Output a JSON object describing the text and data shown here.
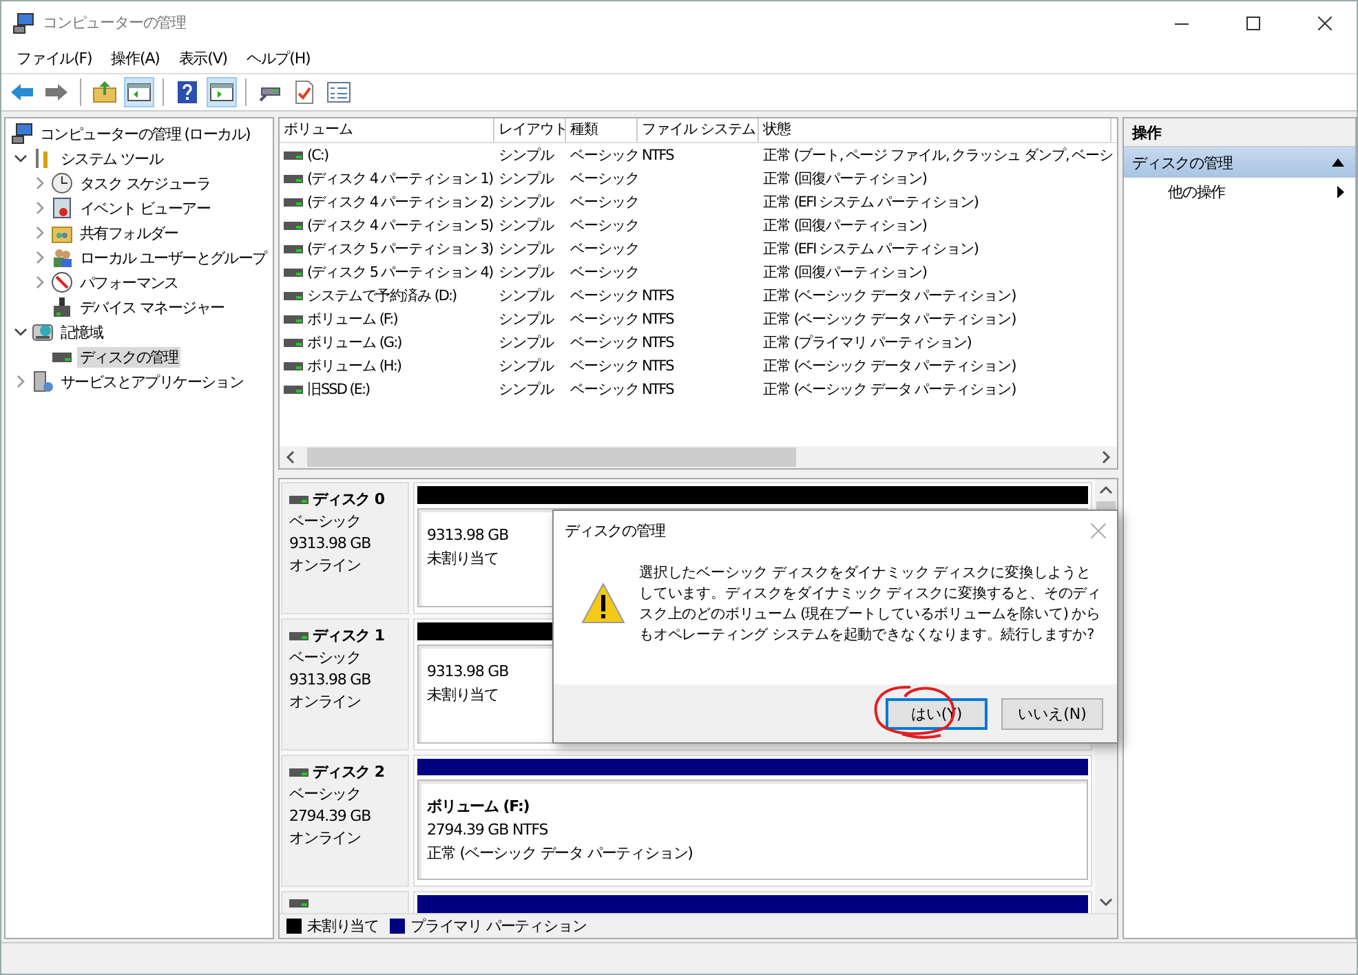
{
  "window": {
    "title": "コンピューターの管理"
  },
  "menu": [
    "ファイル(F)",
    "操作(A)",
    "表示(V)",
    "ヘルプ(H)"
  ],
  "toolbar": [
    {
      "kind": "back",
      "pressed": false
    },
    {
      "kind": "forward",
      "pressed": false
    },
    {
      "kind": "sep"
    },
    {
      "kind": "up",
      "pressed": false
    },
    {
      "kind": "tree",
      "pressed": true
    },
    {
      "kind": "sep"
    },
    {
      "kind": "help",
      "pressed": false
    },
    {
      "kind": "pane",
      "pressed": true
    },
    {
      "kind": "sep"
    },
    {
      "kind": "connect",
      "pressed": false
    },
    {
      "kind": "check",
      "pressed": false
    },
    {
      "kind": "list",
      "pressed": false
    }
  ],
  "tree": [
    {
      "label": "コンピューターの管理 (ローカル)",
      "selected": false,
      "children": [
        {
          "label": "システム ツール",
          "expanded": true,
          "selected": false,
          "children": [
            {
              "label": "タスク スケジューラ",
              "expanded": false,
              "selected": false
            },
            {
              "label": "イベント ビューアー",
              "expanded": false,
              "selected": false
            },
            {
              "label": "共有フォルダー",
              "expanded": false,
              "selected": false
            },
            {
              "label": "ローカル ユーザーとグループ",
              "expanded": false,
              "selected": false
            },
            {
              "label": "パフォーマンス",
              "expanded": false,
              "selected": false
            },
            {
              "label": "デバイス マネージャー",
              "selected": false
            }
          ]
        },
        {
          "label": "記憶域",
          "expanded": true,
          "selected": false,
          "children": [
            {
              "label": "ディスクの管理",
              "selected": true
            }
          ]
        },
        {
          "label": "サービスとアプリケーション",
          "expanded": false,
          "selected": false
        }
      ]
    }
  ],
  "volume_table": {
    "columns": [
      "ボリューム",
      "レイアウト",
      "種類",
      "ファイル システム",
      "状態"
    ],
    "rows": [
      [
        "(C:)",
        "シンプル",
        "ベーシック",
        "NTFS",
        "正常 (ブート, ページ ファイル, クラッシュ ダンプ, ベーシ"
      ],
      [
        "(ディスク 4 パーティション 1)",
        "シンプル",
        "ベーシック",
        "",
        "正常 (回復パーティション)"
      ],
      [
        "(ディスク 4 パーティション 2)",
        "シンプル",
        "ベーシック",
        "",
        "正常 (EFI システム パーティション)"
      ],
      [
        "(ディスク 4 パーティション 5)",
        "シンプル",
        "ベーシック",
        "",
        "正常 (回復パーティション)"
      ],
      [
        "(ディスク 5 パーティション 3)",
        "シンプル",
        "ベーシック",
        "",
        "正常 (EFI システム パーティション)"
      ],
      [
        "(ディスク 5 パーティション 4)",
        "シンプル",
        "ベーシック",
        "",
        "正常 (回復パーティション)"
      ],
      [
        "システムで予約済み (D:)",
        "シンプル",
        "ベーシック",
        "NTFS",
        "正常 (ベーシック データ パーティション)"
      ],
      [
        "ボリューム (F:)",
        "シンプル",
        "ベーシック",
        "NTFS",
        "正常 (ベーシック データ パーティション)"
      ],
      [
        "ボリューム (G:)",
        "シンプル",
        "ベーシック",
        "NTFS",
        "正常 (プライマリ パーティション)"
      ],
      [
        "ボリューム (H:)",
        "シンプル",
        "ベーシック",
        "NTFS",
        "正常 (ベーシック データ パーティション)"
      ],
      [
        "旧SSD (E:)",
        "シンプル",
        "ベーシック",
        "NTFS",
        "正常 (ベーシック データ パーティション)"
      ]
    ]
  },
  "disks": [
    {
      "name": "ディスク 0",
      "type": "ベーシック",
      "size": "9313.98 GB",
      "status": "オンライン",
      "partition": {
        "kind": "unallocated",
        "lines": [
          "9313.98 GB",
          "未割り当て"
        ]
      }
    },
    {
      "name": "ディスク 1",
      "type": "ベーシック",
      "size": "9313.98 GB",
      "status": "オンライン",
      "partition": {
        "kind": "unallocated",
        "lines": [
          "9313.98 GB",
          "未割り当て"
        ]
      }
    },
    {
      "name": "ディスク 2",
      "type": "ベーシック",
      "size": "2794.39 GB",
      "status": "オンライン",
      "partition": {
        "kind": "primary",
        "title": "ボリューム  (F:)",
        "lines": [
          "2794.39 GB NTFS",
          "正常 (ベーシック データ パーティション)"
        ]
      }
    },
    {
      "partition": {
        "kind": "primary"
      }
    }
  ],
  "legend": [
    {
      "label": "未割り当て",
      "color": "#000000"
    },
    {
      "label": "プライマリ パーティション",
      "color": "#000080"
    }
  ],
  "actions": {
    "header": "操作",
    "section": "ディスクの管理",
    "items": [
      "他の操作"
    ]
  },
  "dialog": {
    "title": "ディスクの管理",
    "message": "選択したベーシック ディスクをダイナミック ディスクに変換しようとしています。ディスクをダイナミック ディスクに変換すると、そのディスク上のどのボリューム (現在ブートしているボリュームを除いて) からもオペレーティング システムを起動できなくなります。続行しますか?",
    "buttons": [
      {
        "label": "はい(Y)",
        "default": true,
        "circled": true
      },
      {
        "label": "いいえ(N)",
        "default": false,
        "circled": false
      }
    ]
  }
}
